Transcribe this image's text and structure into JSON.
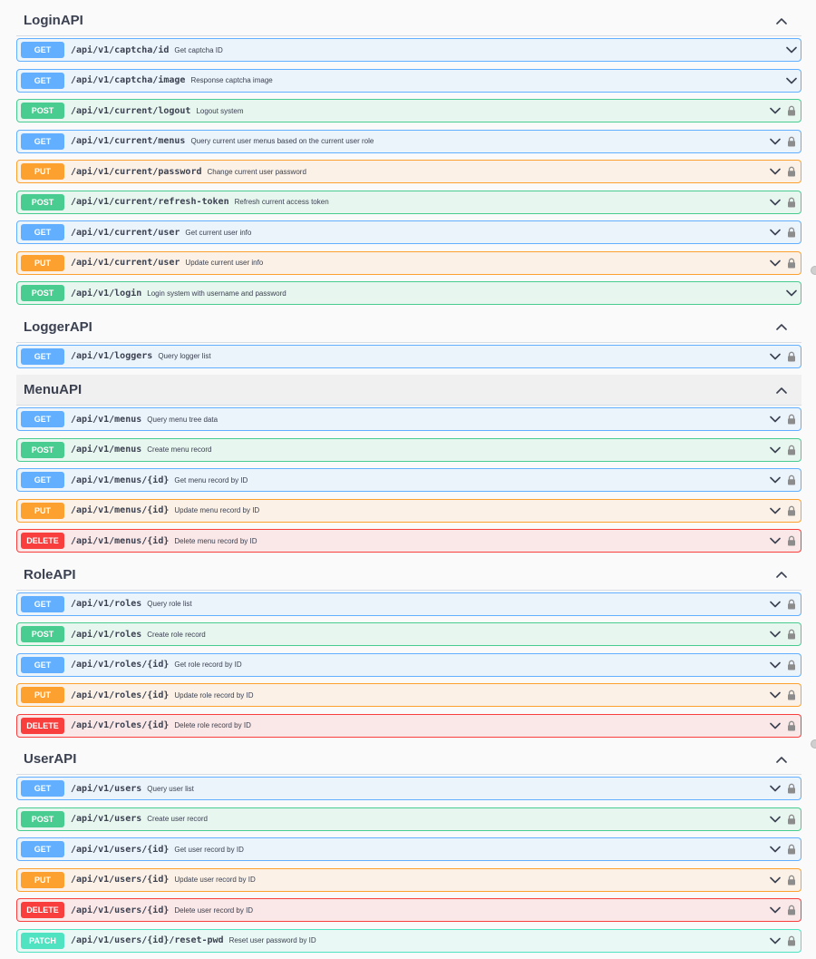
{
  "sections": [
    {
      "title": "LoginAPI",
      "highlight": false,
      "operations": [
        {
          "method": "GET",
          "path": "/api/v1/captcha/id",
          "summary": "Get captcha ID",
          "locked": false
        },
        {
          "method": "GET",
          "path": "/api/v1/captcha/image",
          "summary": "Response captcha image",
          "locked": false
        },
        {
          "method": "POST",
          "path": "/api/v1/current/logout",
          "summary": "Logout system",
          "locked": true
        },
        {
          "method": "GET",
          "path": "/api/v1/current/menus",
          "summary": "Query current user menus based on the current user role",
          "locked": true
        },
        {
          "method": "PUT",
          "path": "/api/v1/current/password",
          "summary": "Change current user password",
          "locked": true
        },
        {
          "method": "POST",
          "path": "/api/v1/current/refresh-token",
          "summary": "Refresh current access token",
          "locked": true
        },
        {
          "method": "GET",
          "path": "/api/v1/current/user",
          "summary": "Get current user info",
          "locked": true
        },
        {
          "method": "PUT",
          "path": "/api/v1/current/user",
          "summary": "Update current user info",
          "locked": true
        },
        {
          "method": "POST",
          "path": "/api/v1/login",
          "summary": "Login system with username and password",
          "locked": false
        }
      ]
    },
    {
      "title": "LoggerAPI",
      "highlight": false,
      "operations": [
        {
          "method": "GET",
          "path": "/api/v1/loggers",
          "summary": "Query logger list",
          "locked": true
        }
      ]
    },
    {
      "title": "MenuAPI",
      "highlight": true,
      "operations": [
        {
          "method": "GET",
          "path": "/api/v1/menus",
          "summary": "Query menu tree data",
          "locked": true
        },
        {
          "method": "POST",
          "path": "/api/v1/menus",
          "summary": "Create menu record",
          "locked": true
        },
        {
          "method": "GET",
          "path": "/api/v1/menus/{id}",
          "summary": "Get menu record by ID",
          "locked": true
        },
        {
          "method": "PUT",
          "path": "/api/v1/menus/{id}",
          "summary": "Update menu record by ID",
          "locked": true
        },
        {
          "method": "DELETE",
          "path": "/api/v1/menus/{id}",
          "summary": "Delete menu record by ID",
          "locked": true
        }
      ]
    },
    {
      "title": "RoleAPI",
      "highlight": false,
      "operations": [
        {
          "method": "GET",
          "path": "/api/v1/roles",
          "summary": "Query role list",
          "locked": true
        },
        {
          "method": "POST",
          "path": "/api/v1/roles",
          "summary": "Create role record",
          "locked": true
        },
        {
          "method": "GET",
          "path": "/api/v1/roles/{id}",
          "summary": "Get role record by ID",
          "locked": true
        },
        {
          "method": "PUT",
          "path": "/api/v1/roles/{id}",
          "summary": "Update role record by ID",
          "locked": true
        },
        {
          "method": "DELETE",
          "path": "/api/v1/roles/{id}",
          "summary": "Delete role record by ID",
          "locked": true
        }
      ]
    },
    {
      "title": "UserAPI",
      "highlight": false,
      "operations": [
        {
          "method": "GET",
          "path": "/api/v1/users",
          "summary": "Query user list",
          "locked": true
        },
        {
          "method": "POST",
          "path": "/api/v1/users",
          "summary": "Create user record",
          "locked": true
        },
        {
          "method": "GET",
          "path": "/api/v1/users/{id}",
          "summary": "Get user record by ID",
          "locked": true
        },
        {
          "method": "PUT",
          "path": "/api/v1/users/{id}",
          "summary": "Update user record by ID",
          "locked": true
        },
        {
          "method": "DELETE",
          "path": "/api/v1/users/{id}",
          "summary": "Delete user record by ID",
          "locked": true
        },
        {
          "method": "PATCH",
          "path": "/api/v1/users/{id}/reset-pwd",
          "summary": "Reset user password by ID",
          "locked": true
        }
      ]
    }
  ],
  "icons": {
    "section_toggle": "chevron-up-icon",
    "operation_toggle": "chevron-down-icon",
    "auth": "lock-icon"
  },
  "colors": {
    "get": "#61affe",
    "post": "#49cc90",
    "put": "#fca130",
    "delete": "#f93e3e",
    "patch": "#50e3c2"
  }
}
